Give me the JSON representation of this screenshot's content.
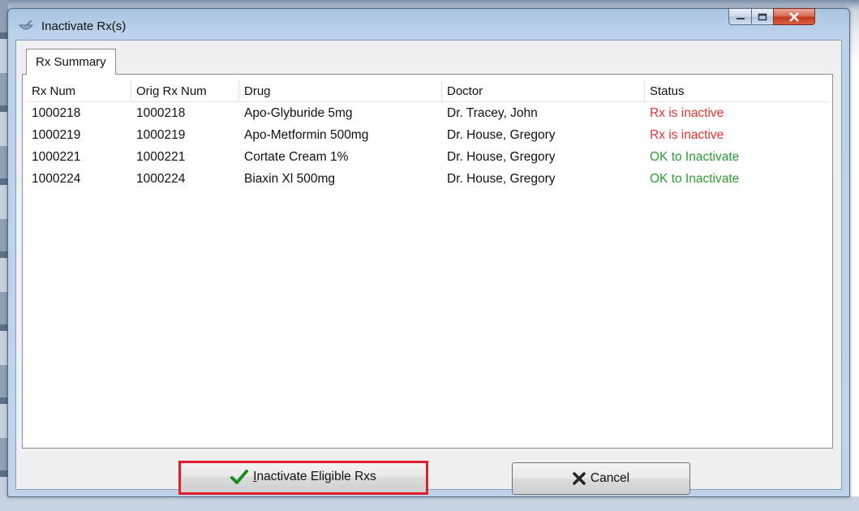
{
  "window": {
    "title": "Inactivate Rx(s)"
  },
  "tab": {
    "label": "Rx Summary"
  },
  "table": {
    "columns": [
      "Rx Num",
      "Orig Rx Num",
      "Drug",
      "Doctor",
      "Status"
    ],
    "rows": [
      {
        "rx_num": "1000218",
        "orig_rx_num": "1000218",
        "drug": "Apo-Glyburide 5mg",
        "doctor": "Dr. Tracey, John",
        "status": "Rx is inactive",
        "status_color": "#e8322f"
      },
      {
        "rx_num": "1000219",
        "orig_rx_num": "1000219",
        "drug": "Apo-Metformin 500mg",
        "doctor": "Dr. House, Gregory",
        "status": "Rx is inactive",
        "status_color": "#e8322f"
      },
      {
        "rx_num": "1000221",
        "orig_rx_num": "1000221",
        "drug": "Cortate Cream 1%",
        "doctor": "Dr. House, Gregory",
        "status": "OK to Inactivate",
        "status_color": "#2a9c31"
      },
      {
        "rx_num": "1000224",
        "orig_rx_num": "1000224",
        "drug": "Biaxin Xl 500mg",
        "doctor": "Dr. House, Gregory",
        "status": "OK to Inactivate",
        "status_color": "#2a9c31"
      }
    ]
  },
  "buttons": {
    "inactivate_mnemonic": "I",
    "inactivate_rest": "nactivate Eligible Rxs",
    "inactivate_icon": "checkmark-icon",
    "cancel_label": "Cancel",
    "cancel_icon": "x-icon"
  },
  "colors": {
    "highlight_border": "#e01e2c",
    "inactive_status": "#e8322f",
    "ok_status": "#2a9c31"
  }
}
